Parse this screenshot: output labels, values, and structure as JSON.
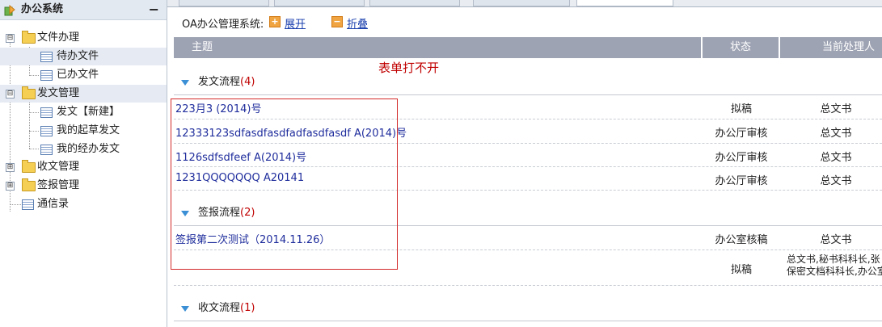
{
  "sidebar": {
    "title": "办公系统",
    "collapse_symbol": "−",
    "items": [
      {
        "label": "文件办理",
        "expander": "⊟"
      },
      {
        "label": "待办文件"
      },
      {
        "label": "已办文件"
      },
      {
        "label": "发文管理",
        "expander": "⊟"
      },
      {
        "label": "发文【新建】"
      },
      {
        "label": "我的起草发文"
      },
      {
        "label": "我的经办发文"
      },
      {
        "label": "收文管理",
        "expander": "⊞"
      },
      {
        "label": "签报管理",
        "expander": "⊞"
      },
      {
        "label": "通信录"
      }
    ]
  },
  "toolbar": {
    "title": "OA办公管理系统:",
    "expand_icon": "+",
    "expand_label": "展开",
    "collapse_icon": "−",
    "collapse_label": "折叠"
  },
  "table": {
    "headers": {
      "subject": "主题",
      "status": "状态",
      "handler": "当前处理人"
    },
    "groups": [
      {
        "name": "发文流程",
        "count": "(4)"
      },
      {
        "name": "签报流程",
        "count": "(2)"
      },
      {
        "name": "收文流程",
        "count": "(1)"
      }
    ],
    "rows": [
      {
        "subject": "223月3 (2014)号",
        "status": "拟稿",
        "handler": "总文书"
      },
      {
        "subject": "12333123sdfasdfasdfadfasdfasdf A(2014)号",
        "status": "办公厅审核",
        "handler": "总文书"
      },
      {
        "subject": "1126sdfsdfeef A(2014)号",
        "status": "办公厅审核",
        "handler": "总文书"
      },
      {
        "subject": "1231QQQQQQQ A20141",
        "status": "办公厅审核",
        "handler": "总文书"
      },
      {
        "subject": "签报第二次测试（2014.11.26）",
        "status": "办公室核稿",
        "handler": "总文书"
      },
      {
        "subject": "",
        "status": "拟稿",
        "handler_line1": "总文书,秘书科科长,张",
        "handler_line2": "保密文档科科长,办公室"
      }
    ]
  },
  "annotation": "表单打不开",
  "colors": {
    "link": "#1f2d9c",
    "header_bg": "#9ea3b3",
    "accent_red": "#c00000",
    "tree_arrow": "#3a8fd5"
  }
}
